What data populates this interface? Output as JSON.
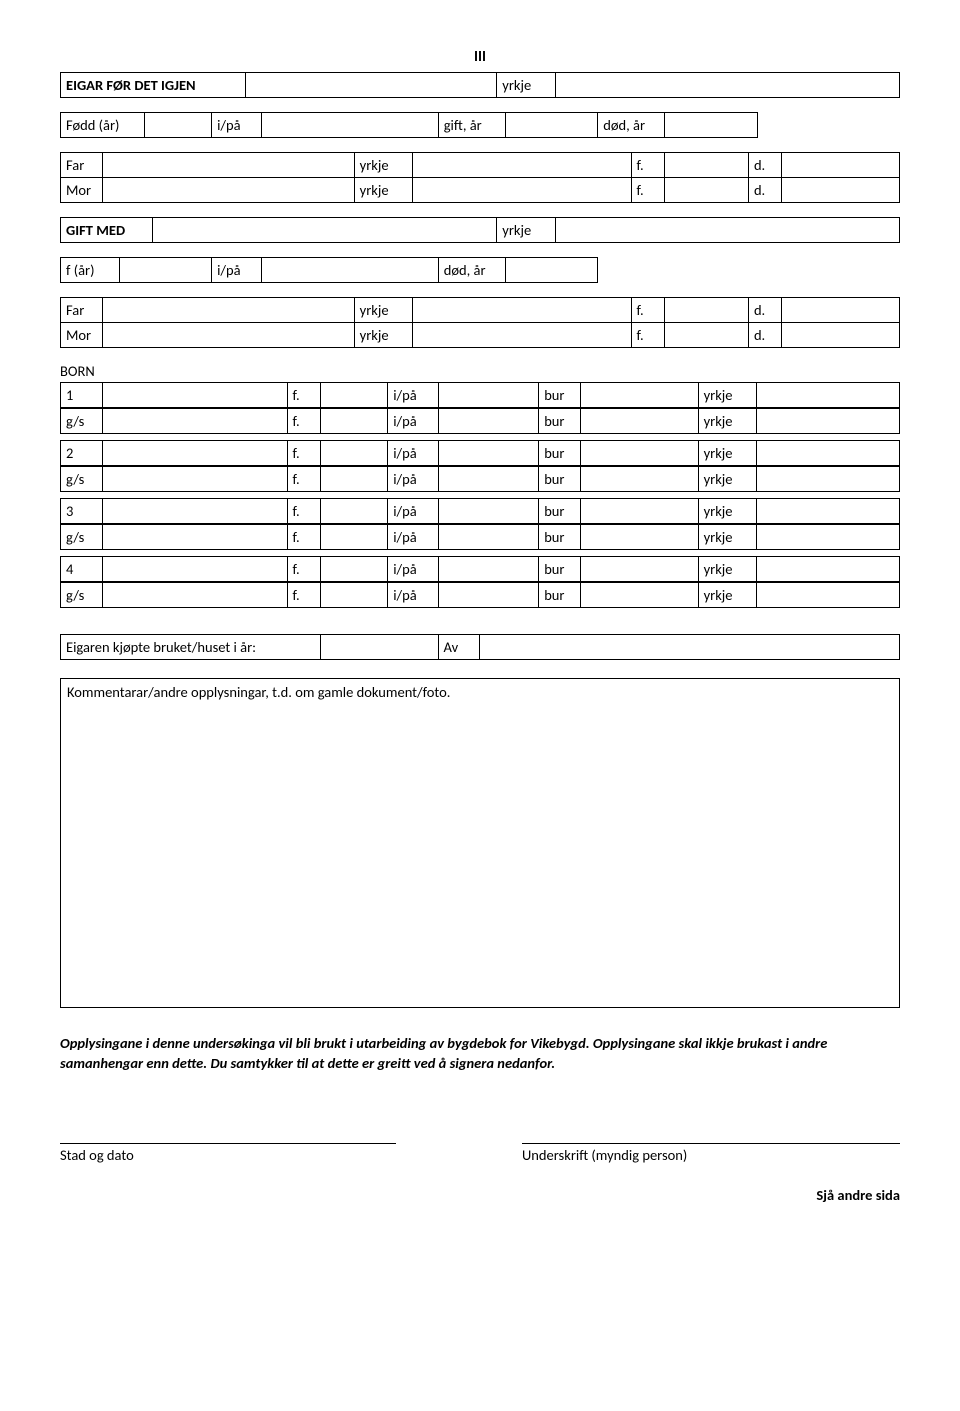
{
  "roman": "III",
  "owner": {
    "label": "EIGAR FØR DET IGJEN",
    "yrkje": "yrkje"
  },
  "birth": {
    "fodd": "Fødd (år)",
    "ipa": "i/på",
    "gift": "gift, år",
    "dod": "død, år"
  },
  "far": {
    "label": "Far",
    "yrkje": "yrkje",
    "f": "f.",
    "d": "d."
  },
  "mor": {
    "label": "Mor",
    "yrkje": "yrkje",
    "f": "f.",
    "d": "d."
  },
  "giftmed": {
    "label": "GIFT MED",
    "yrkje": "yrkje"
  },
  "spouse_row": {
    "far": "f (år)",
    "ipa": "i/på",
    "dod": "død, år"
  },
  "far2": {
    "label": "Far",
    "yrkje": "yrkje",
    "f": "f.",
    "d": "d."
  },
  "mor2": {
    "label": "Mor",
    "yrkje": "yrkje",
    "f": "f.",
    "d": "d."
  },
  "born_label": "BORN",
  "born": [
    {
      "n": "1",
      "f": "f.",
      "ipa": "i/på",
      "bur": "bur",
      "yrkje": "yrkje"
    },
    {
      "n": "g/s",
      "f": "f.",
      "ipa": "i/på",
      "bur": "bur",
      "yrkje": "yrkje"
    },
    {
      "n": "2",
      "f": "f.",
      "ipa": "i/på",
      "bur": "bur",
      "yrkje": "yrkje"
    },
    {
      "n": "g/s",
      "f": "f.",
      "ipa": "i/på",
      "bur": "bur",
      "yrkje": "yrkje"
    },
    {
      "n": "3",
      "f": "f.",
      "ipa": "i/på",
      "bur": "bur",
      "yrkje": "yrkje"
    },
    {
      "n": "g/s",
      "f": "f.",
      "ipa": "i/på",
      "bur": "bur",
      "yrkje": "yrkje"
    },
    {
      "n": "4",
      "f": "f.",
      "ipa": "i/på",
      "bur": "bur",
      "yrkje": "yrkje"
    },
    {
      "n": "g/s",
      "f": "f.",
      "ipa": "i/på",
      "bur": "bur",
      "yrkje": "yrkje"
    }
  ],
  "bought": {
    "label": "Eigaren kjøpte bruket/huset i år:",
    "av": "Av"
  },
  "comment_label": "Kommentarar/andre opplysningar, t.d. om gamle dokument/foto.",
  "consent": "Opplysingane i denne undersøkinga vil bli brukt i utarbeiding av bygdebok for Vikebygd. Opplysingane skal ikkje brukast i andre samanhengar enn dette. Du samtykker til at dette er greitt ved å signera nedanfor.",
  "sig_left": "Stad og dato",
  "sig_right": "Underskrift (myndig person)",
  "footer": "Sjå andre sida"
}
